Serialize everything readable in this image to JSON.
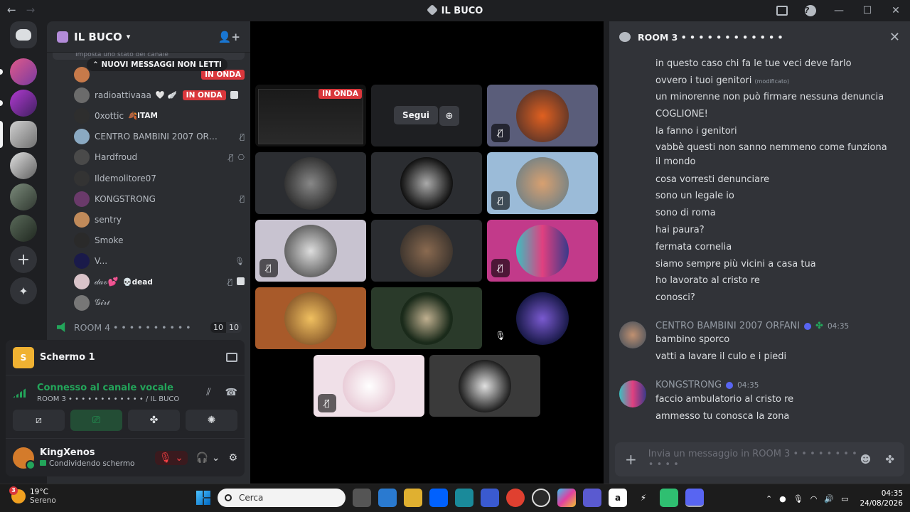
{
  "titlebar": {
    "title": "IL BUCO",
    "back_icon": "arrow-left-icon",
    "forward_icon": "arrow-right-icon"
  },
  "server": {
    "name": "IL BUCO",
    "topic_fragment": "Imposta uno stato del canale",
    "unread_pill": "NUOVI MESSAGGI NON LETTI"
  },
  "members": [
    {
      "name": "",
      "live": "IN ONDA",
      "color": "#c77a4a"
    },
    {
      "name": "radioattivaaa",
      "extra": "🤍 🪽",
      "live": "IN ONDA",
      "color": "#6b6b6b"
    },
    {
      "name": "0xottic",
      "status": "🍂ITAM",
      "color": "#2e2e2e"
    },
    {
      "name": "CENTRO BAMBINI 2007 ORFANI",
      "color": "#8aa9c2"
    },
    {
      "name": "Hardfroud",
      "color": "#4a4a4a"
    },
    {
      "name": "Ildemolitore07",
      "color": "#333333"
    },
    {
      "name": "KONGSTRONG",
      "color": "#6a3a6a"
    },
    {
      "name": "sentry",
      "color": "#c08a5a"
    },
    {
      "name": "Smoke",
      "color": "#2a2a2a"
    },
    {
      "name": "V...",
      "color": "#1a1a4a"
    },
    {
      "name": "𝒹𝒶𝓋💕",
      "status": "💀dead",
      "color": "#d9c3c9"
    },
    {
      "name": "𝒢𝒾𝓇𝓁",
      "color": "#777777"
    }
  ],
  "room4": {
    "label": "ROOM 4 • • • • • • • • • •",
    "count_a": "10",
    "count_b": "10"
  },
  "screen_share": {
    "label": "Schermo 1",
    "icon_letter": "S"
  },
  "voice": {
    "status": "Connesso al canale vocale",
    "channel": "ROOM 3 • • • • • • • • • • • • / IL BUCO"
  },
  "user": {
    "name": "KingXenos",
    "status": "Condividendo schermo"
  },
  "stage": {
    "follow_label": "Segui",
    "live_label": "IN ONDA"
  },
  "chat": {
    "title": "ROOM 3 • • • • • • • • • • • •",
    "lines": [
      "in questo caso chi fa le tue veci deve farlo",
      "ovvero i tuoi genitori",
      "un minorenne non può firmare nessuna denuncia",
      "COGLIONE!",
      "la fanno i genitori",
      "vabbè questi non sanno nemmeno come funziona il mondo",
      "cosa vorresti denunciare",
      "sono un legale io",
      "sono di roma",
      "hai paura?",
      "fermata cornelia",
      "siamo sempre più vicini a casa tua",
      "ho lavorato al cristo re",
      "conosci?"
    ],
    "edited_tag": "(modificato)",
    "group2": {
      "author": "CENTRO BAMBINI 2007 ORFANI",
      "time": "04:35",
      "lines": [
        "bambino sporco",
        "vatti a lavare il culo e i piedi"
      ]
    },
    "group3": {
      "author": "KONGSTRONG",
      "time": "04:35",
      "lines": [
        "faccio ambulatorio al cristo re",
        "ammesso tu conosca la zona"
      ]
    },
    "composer_placeholder": "Invia un messaggio in ROOM 3 • • • • • • • • • • • •"
  },
  "taskbar": {
    "temp": "19°C",
    "weather": "Sereno",
    "weather_badge": "3",
    "search": "Cerca",
    "time": "04:35",
    "date": "24/08/2026"
  }
}
